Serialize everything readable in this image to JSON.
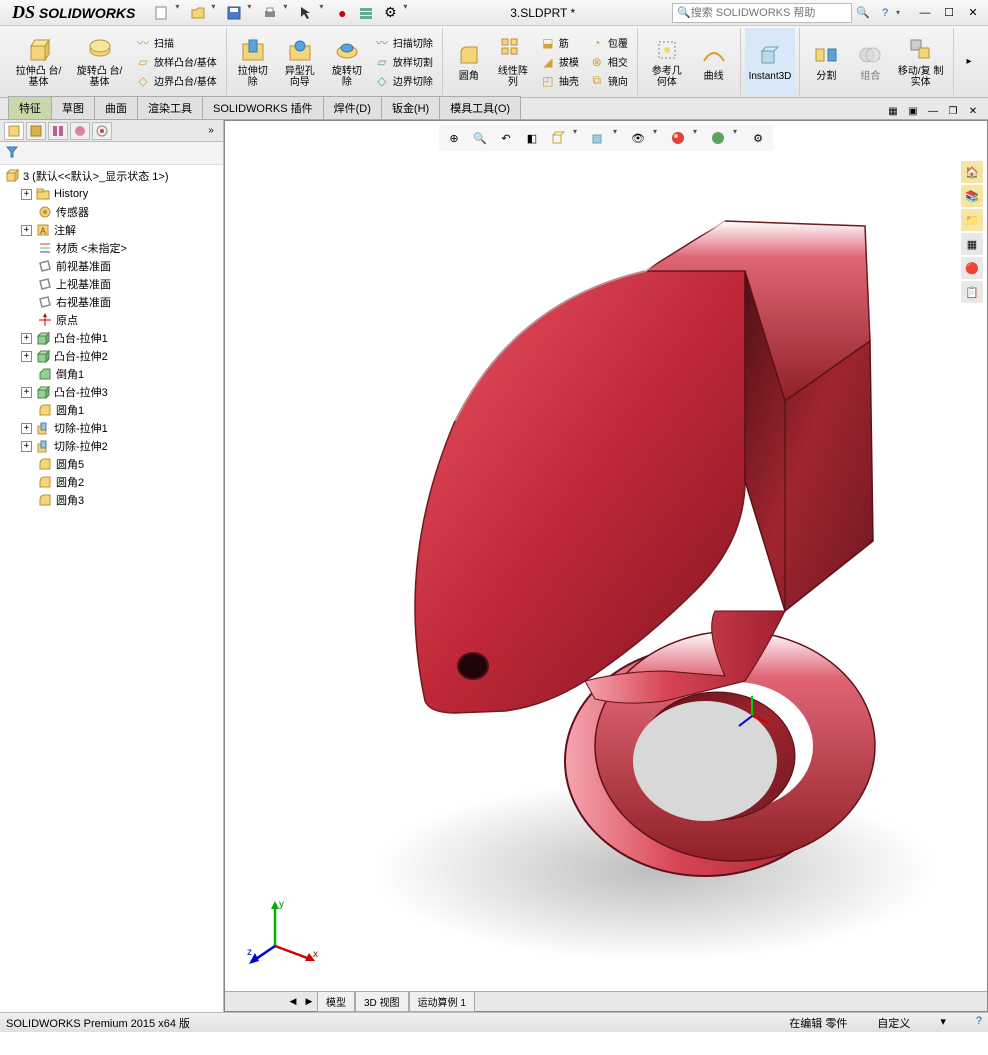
{
  "app": {
    "name": "SOLIDWORKS"
  },
  "doc": {
    "title": "3.SLDPRT *"
  },
  "search": {
    "placeholder": "搜索 SOLIDWORKS 帮助"
  },
  "ribbon": {
    "extrude_boss": "拉伸凸\n台/基体",
    "revolve_boss": "旋转凸\n台/基体",
    "sweep": "扫描",
    "loft": "放样凸台/基体",
    "boundary": "边界凸台/基体",
    "extrude_cut": "拉伸切\n除",
    "hole_wiz": "异型孔\n向导",
    "revolve_cut": "旋转切\n除",
    "sweep_cut": "扫描切除",
    "loft_cut": "放样切割",
    "boundary_cut": "边界切除",
    "fillet": "圆角",
    "lpattern": "线性阵\n列",
    "rib": "筋",
    "draft": "拔模",
    "shell": "抽壳",
    "wrap": "包覆",
    "intersect": "相交",
    "mirror": "镜向",
    "refgeo": "参考几\n何体",
    "curves": "曲线",
    "instant3d": "Instant3D",
    "split": "分割",
    "combine": "组合",
    "move_copy": "移动/复\n制实体"
  },
  "tabs": {
    "items": [
      "特征",
      "草图",
      "曲面",
      "渲染工具",
      "SOLIDWORKS 插件",
      "焊件(D)",
      "钣金(H)",
      "模具工具(O)"
    ],
    "active": 0
  },
  "tree": {
    "root": "3 (默认<<默认>_显示状态 1>)",
    "items": [
      {
        "icon": "folder",
        "label": "History",
        "exp": "+",
        "indent": 1
      },
      {
        "icon": "sensor",
        "label": "传感器",
        "indent": 1
      },
      {
        "icon": "annot",
        "label": "注解",
        "exp": "+",
        "indent": 1
      },
      {
        "icon": "material",
        "label": "材质 <未指定>",
        "indent": 1
      },
      {
        "icon": "plane",
        "label": "前视基准面",
        "indent": 1
      },
      {
        "icon": "plane",
        "label": "上视基准面",
        "indent": 1
      },
      {
        "icon": "plane",
        "label": "右视基准面",
        "indent": 1
      },
      {
        "icon": "origin",
        "label": "原点",
        "indent": 1
      },
      {
        "icon": "extrude",
        "label": "凸台-拉伸1",
        "exp": "+",
        "indent": 1
      },
      {
        "icon": "extrude",
        "label": "凸台-拉伸2",
        "exp": "+",
        "indent": 1
      },
      {
        "icon": "chamfer",
        "label": "倒角1",
        "indent": 1
      },
      {
        "icon": "extrude",
        "label": "凸台-拉伸3",
        "exp": "+",
        "indent": 1
      },
      {
        "icon": "fillet",
        "label": "圆角1",
        "indent": 1
      },
      {
        "icon": "cut",
        "label": "切除-拉伸1",
        "exp": "+",
        "indent": 1
      },
      {
        "icon": "cut",
        "label": "切除-拉伸2",
        "exp": "+",
        "indent": 1
      },
      {
        "icon": "fillet",
        "label": "圆角5",
        "indent": 1
      },
      {
        "icon": "fillet",
        "label": "圆角2",
        "indent": 1
      },
      {
        "icon": "fillet",
        "label": "圆角3",
        "indent": 1
      }
    ]
  },
  "bottom_tabs": [
    "模型",
    "3D 视图",
    "运动算例 1"
  ],
  "status": {
    "left": "SOLIDWORKS Premium 2015 x64 版",
    "mode": "在编辑 零件",
    "custom": "自定义"
  },
  "triad": {
    "x": "x",
    "y": "y",
    "z": "z"
  }
}
